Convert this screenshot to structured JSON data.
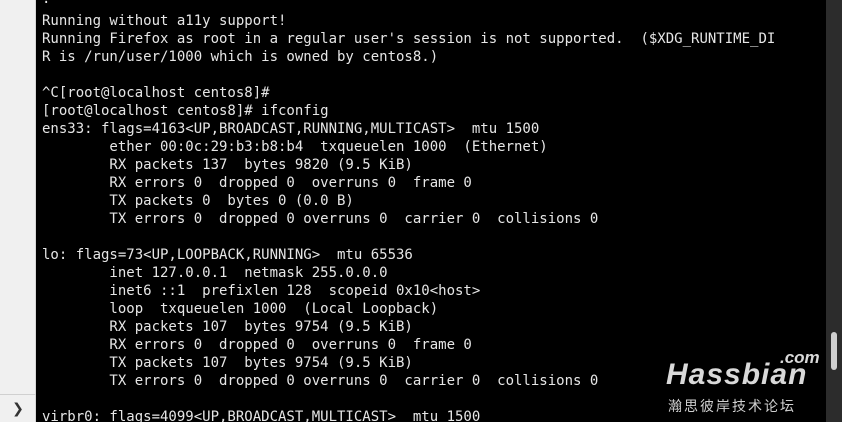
{
  "side_panel": {
    "expand_glyph": "❯"
  },
  "terminal": {
    "lines": [
      "·",
      "Running without a11y support!",
      "Running Firefox as root in a regular user's session is not supported.  ($XDG_RUNTIME_DI",
      "R is /run/user/1000 which is owned by centos8.)",
      "",
      "^C[root@localhost centos8]#",
      "[root@localhost centos8]# ifconfig",
      "ens33: flags=4163<UP,BROADCAST,RUNNING,MULTICAST>  mtu 1500",
      "        ether 00:0c:29:b3:b8:b4  txqueuelen 1000  (Ethernet)",
      "        RX packets 137  bytes 9820 (9.5 KiB)",
      "        RX errors 0  dropped 0  overruns 0  frame 0",
      "        TX packets 0  bytes 0 (0.0 B)",
      "        TX errors 0  dropped 0 overruns 0  carrier 0  collisions 0",
      "",
      "lo: flags=73<UP,LOOPBACK,RUNNING>  mtu 65536",
      "        inet 127.0.0.1  netmask 255.0.0.0",
      "        inet6 ::1  prefixlen 128  scopeid 0x10<host>",
      "        loop  txqueuelen 1000  (Local Loopback)",
      "        RX packets 107  bytes 9754 (9.5 KiB)",
      "        RX errors 0  dropped 0  overruns 0  frame 0",
      "        TX packets 107  bytes 9754 (9.5 KiB)",
      "        TX errors 0  dropped 0 overruns 0  carrier 0  collisions 0",
      "",
      "virbr0: flags=4099<UP,BROADCAST,MULTICAST>  mtu 1500"
    ]
  },
  "watermark": {
    "com": ".com",
    "brand": "Hassbian",
    "tagline": "瀚思彼岸技术论坛"
  },
  "colors": {
    "terminal_bg": "#000000",
    "terminal_fg": "#e6e6e6",
    "panel_bg": "#f0f0f0"
  }
}
